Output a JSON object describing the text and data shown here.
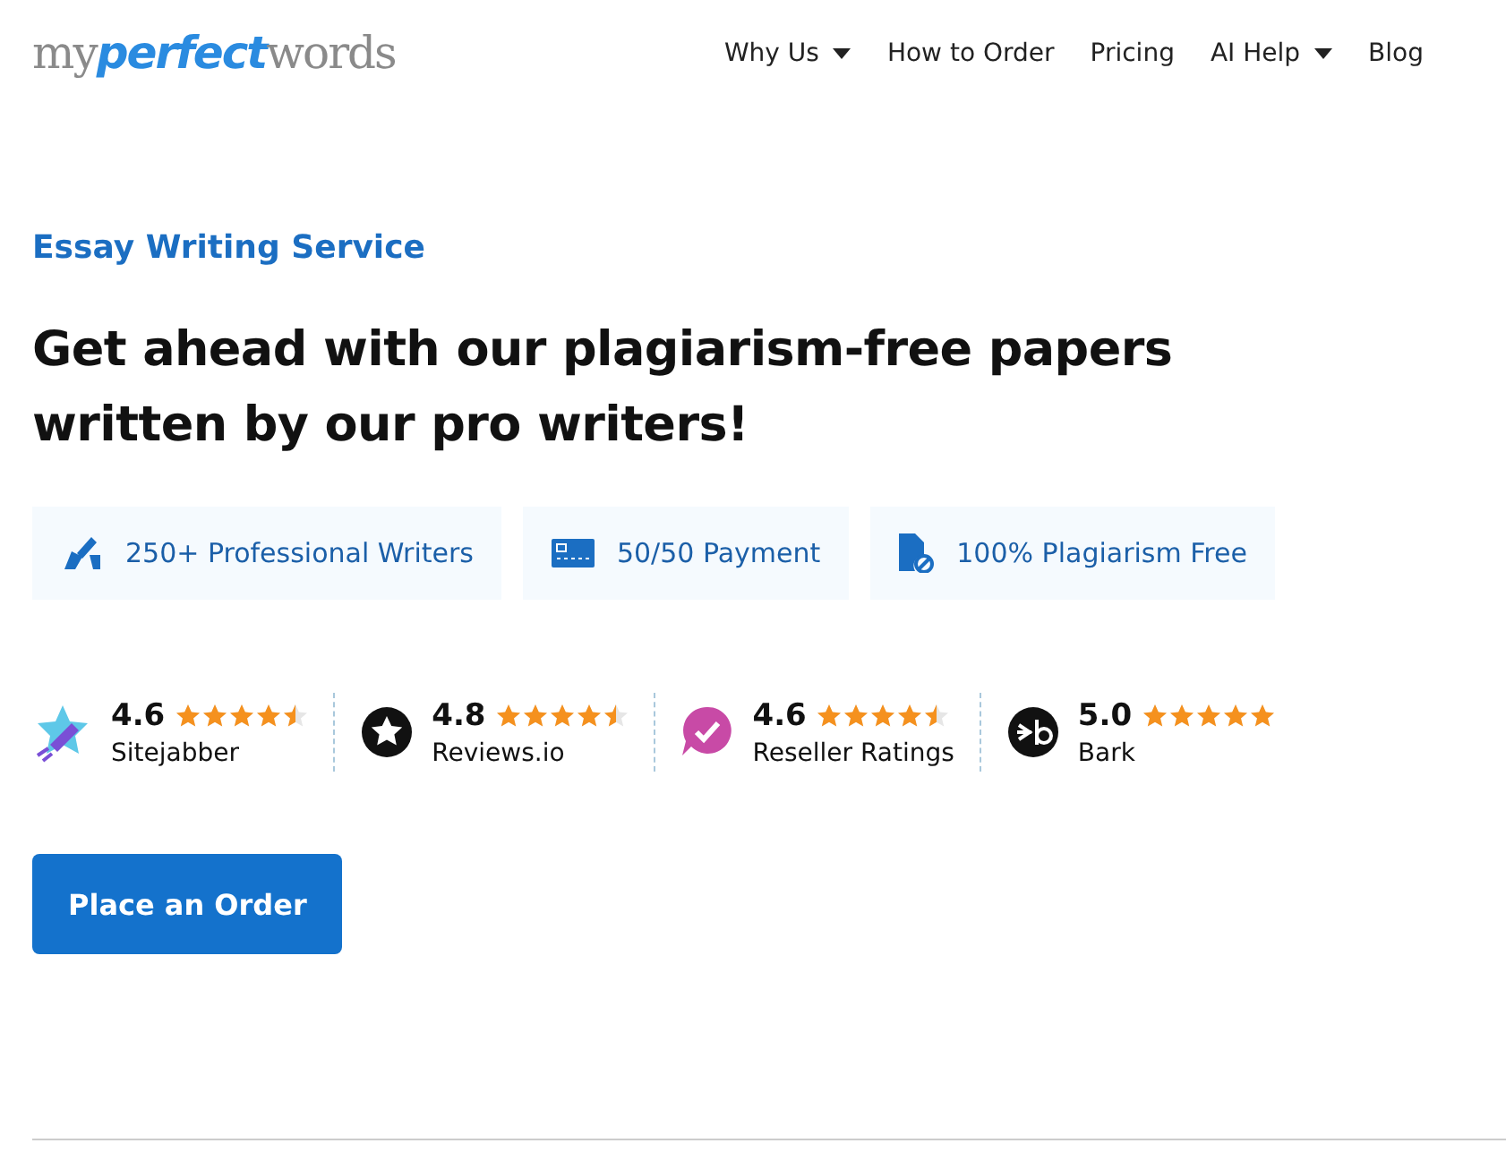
{
  "logo": [
    {
      "text": "my",
      "kind": "plain"
    },
    {
      "text": "perfect",
      "kind": "accent"
    },
    {
      "text": "words",
      "kind": "plain"
    }
  ],
  "nav": [
    {
      "label": "Why Us",
      "dropdown": true
    },
    {
      "label": "How to Order",
      "dropdown": false
    },
    {
      "label": "Pricing",
      "dropdown": false
    },
    {
      "label": "AI Help",
      "dropdown": true
    },
    {
      "label": "Blog",
      "dropdown": false
    }
  ],
  "eyebrow": "Essay Writing Service",
  "headline": "Get ahead with our plagiarism-free papers written by our pro writers!",
  "features": [
    {
      "label": "250+ Professional Writers",
      "kind": "writer"
    },
    {
      "label": "50/50 Payment",
      "kind": "card"
    },
    {
      "label": "100% Plagiarism Free",
      "kind": "document"
    }
  ],
  "ratings": [
    {
      "score": "4.6",
      "stars": 4.5,
      "name": "Sitejabber",
      "kind": "rocket"
    },
    {
      "score": "4.8",
      "stars": 4.5,
      "name": "Reviews.io",
      "kind": "star"
    },
    {
      "score": "4.6",
      "stars": 4.5,
      "name": "Reseller Ratings",
      "kind": "check"
    },
    {
      "score": "5.0",
      "stars": 5,
      "name": "Bark",
      "kind": "bark"
    }
  ],
  "cta": "Place an Order"
}
